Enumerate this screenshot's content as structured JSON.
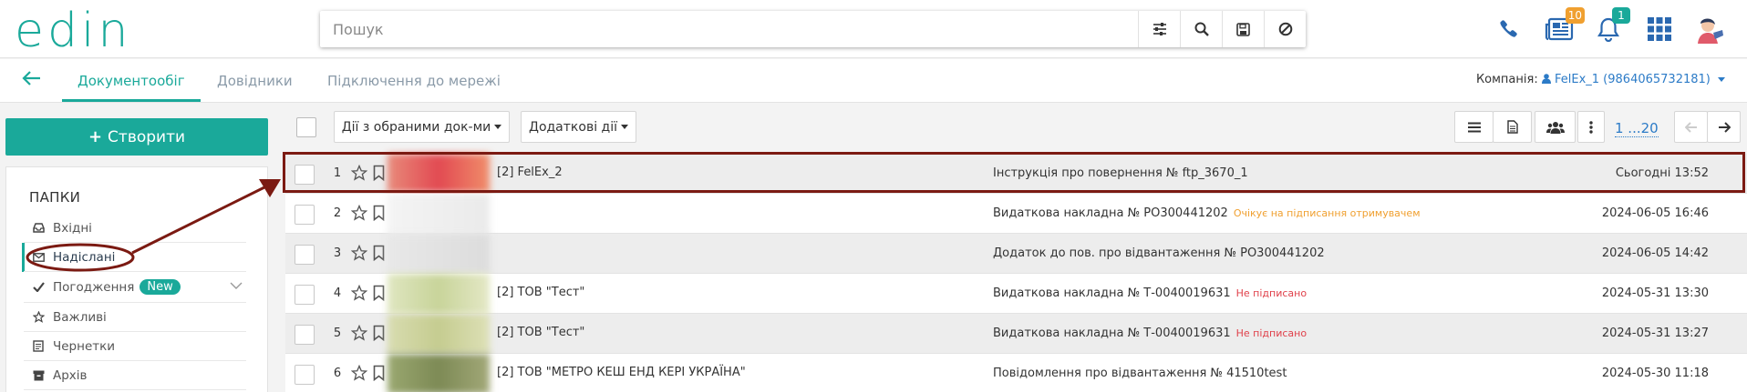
{
  "header": {
    "logo": "edin",
    "search_placeholder": "Пошук",
    "icons": [
      "filter-settings-icon",
      "search-icon",
      "save-icon",
      "clear-icon"
    ],
    "right_icons": {
      "phone": "phone-icon",
      "news": "news-icon",
      "news_badge": "10",
      "bell": "bell-icon",
      "bell_badge": "1",
      "apps": "apps-grid-icon",
      "avatar": "avatar"
    }
  },
  "nav": {
    "tabs": [
      {
        "label": "Документообіг",
        "active": true
      },
      {
        "label": "Довідники",
        "active": false
      },
      {
        "label": "Підключення до мережі",
        "active": false
      }
    ],
    "company_label": "Компанія:",
    "company_value": "FelEx_1 (9864065732181)"
  },
  "sidebar": {
    "create_label": "Створити",
    "folders_title": "ПАПКИ",
    "items": [
      {
        "label": "Вхідні",
        "icon": "inbox-icon"
      },
      {
        "label": "Надіслані",
        "icon": "envelope-icon",
        "active": true
      },
      {
        "label": "Погодження",
        "icon": "check-icon",
        "badge": "New"
      },
      {
        "label": "Важливі",
        "icon": "star-icon"
      },
      {
        "label": "Чернетки",
        "icon": "drafts-icon"
      },
      {
        "label": "Архів",
        "icon": "archive-icon"
      }
    ]
  },
  "toolbar": {
    "actions_selected": "Дії з обраними док-ми",
    "extra_actions": "Додаткові дії",
    "view_icons": [
      "list-view-icon",
      "document-view-icon",
      "group-icon",
      "more-vertical-icon"
    ],
    "pager": "1 ...20"
  },
  "rows": [
    {
      "num": "1",
      "sender": "[2] FelEx_2",
      "doc": "Інструкція про повернення № ftp_3670_1",
      "status": "",
      "date": "Сьогодні 13:52"
    },
    {
      "num": "2",
      "sender": "",
      "doc": "Видаткова накладна № РО300441202",
      "status": "Очікує на підписання отримувачем",
      "date": "2024-06-05 16:46"
    },
    {
      "num": "3",
      "sender": "",
      "doc": "Додаток до пов. про відвантаження № РО300441202",
      "status": "",
      "date": "2024-06-05 14:42"
    },
    {
      "num": "4",
      "sender": "[2] ТОВ \"Тест\"",
      "doc": "Видаткова накладна № Т-0040019631",
      "status": "Не підписано",
      "date": "2024-05-31 13:30"
    },
    {
      "num": "5",
      "sender": "[2] ТОВ \"Тест\"",
      "doc": "Видаткова накладна № Т-0040019631",
      "status": "Не підписано",
      "date": "2024-05-31 13:27"
    },
    {
      "num": "6",
      "sender": "[2] ТОВ \"МЕТРО КЕШ ЕНД КЕРІ УКРАЇНА\"",
      "doc": "Повідомлення про відвантаження № 41510test",
      "status": "",
      "date": "2024-05-30 11:18"
    }
  ],
  "colors": {
    "accent": "#1aa99a",
    "link": "#2c7bc7",
    "status_pending": "#f0a030",
    "status_unsigned": "#e0404a",
    "annotation": "#7b1a12",
    "badge_orange": "#f0a030",
    "badge_green": "#1aa99a"
  }
}
